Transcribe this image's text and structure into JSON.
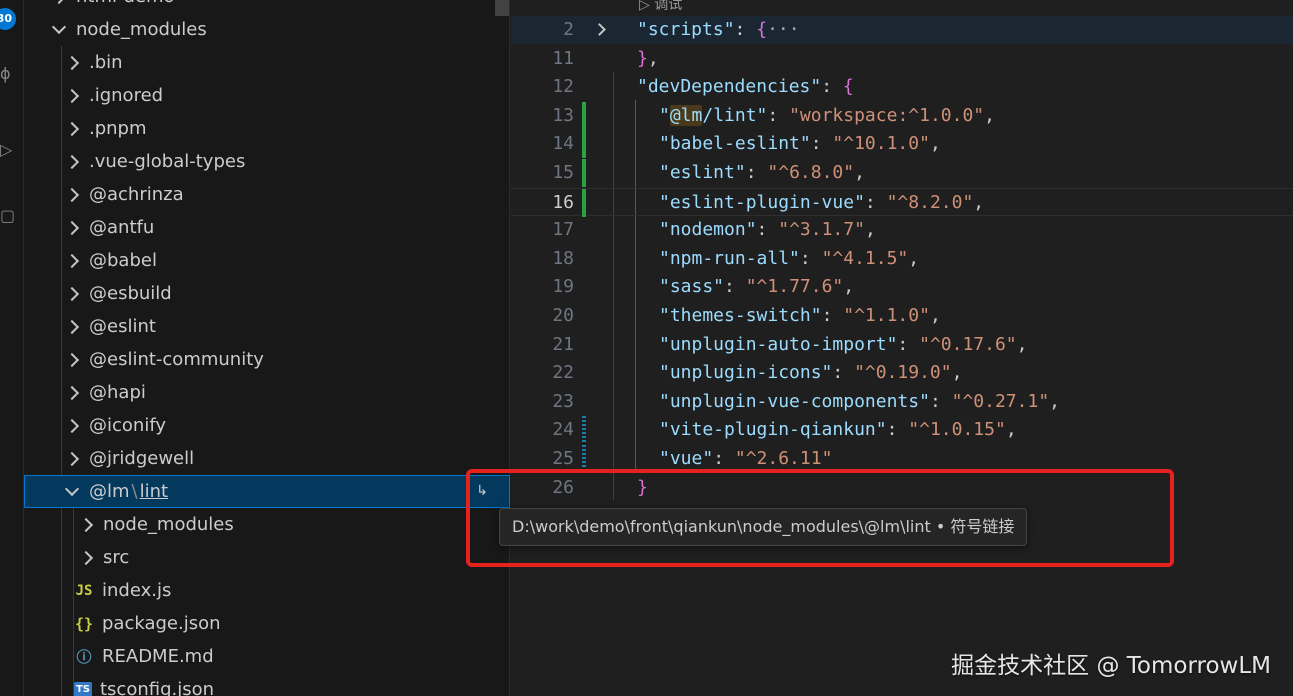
{
  "activity_bar": {
    "badge": "30",
    "icons": [
      "source-control-icon",
      "run-debug-icon",
      "extensions-icon"
    ]
  },
  "explorer": {
    "partial_top": "html-demo",
    "items": [
      {
        "label": "node_modules",
        "expanded": true,
        "depth": 0
      },
      {
        "label": ".bin",
        "expanded": false,
        "depth": 1
      },
      {
        "label": ".ignored",
        "expanded": false,
        "depth": 1
      },
      {
        "label": ".pnpm",
        "expanded": false,
        "depth": 1
      },
      {
        "label": ".vue-global-types",
        "expanded": false,
        "depth": 1
      },
      {
        "label": "@achrinza",
        "expanded": false,
        "depth": 1
      },
      {
        "label": "@antfu",
        "expanded": false,
        "depth": 1
      },
      {
        "label": "@babel",
        "expanded": false,
        "depth": 1
      },
      {
        "label": "@esbuild",
        "expanded": false,
        "depth": 1
      },
      {
        "label": "@eslint",
        "expanded": false,
        "depth": 1
      },
      {
        "label": "@eslint-community",
        "expanded": false,
        "depth": 1
      },
      {
        "label": "@hapi",
        "expanded": false,
        "depth": 1
      },
      {
        "label": "@iconify",
        "expanded": false,
        "depth": 1
      },
      {
        "label": "@jridgewell",
        "expanded": false,
        "depth": 1
      }
    ],
    "selected": {
      "scope": "@lm",
      "separator": "\\",
      "name": "lint"
    },
    "children": [
      {
        "label": "node_modules",
        "kind": "folder"
      },
      {
        "label": "src",
        "kind": "folder"
      },
      {
        "label": "index.js",
        "kind": "js",
        "icon_text": "JS"
      },
      {
        "label": "package.json",
        "kind": "json",
        "icon_text": "{}"
      },
      {
        "label": "README.md",
        "kind": "info",
        "icon_text": "ⓘ"
      },
      {
        "label": "tsconfig.json",
        "kind": "ts",
        "icon_text": "TS"
      }
    ],
    "symlink_glyph": "↳"
  },
  "editor": {
    "run_hint": "▷ 调试",
    "lines": [
      {
        "n": "2",
        "segs": [
          [
            "k",
            "\"scripts\""
          ],
          [
            "p",
            ": "
          ],
          [
            "b1",
            "{"
          ],
          [
            "e",
            "···"
          ]
        ],
        "fold": true,
        "sticky": true
      },
      {
        "n": "11",
        "segs": [
          [
            "b1",
            "}"
          ],
          [
            "p",
            ","
          ]
        ]
      },
      {
        "n": "12",
        "segs": [
          [
            "k",
            "\"devDependencies\""
          ],
          [
            "p",
            ": "
          ],
          [
            "b1",
            "{"
          ]
        ]
      },
      {
        "n": "13",
        "segs": [
          [
            "k",
            "\""
          ],
          [
            "khl",
            "@lm"
          ],
          [
            "k",
            "/lint\""
          ],
          [
            "p",
            ": "
          ],
          [
            "s",
            "\"workspace:^1.0.0\""
          ],
          [
            "p",
            ","
          ]
        ],
        "diff": "add",
        "indent": true
      },
      {
        "n": "14",
        "segs": [
          [
            "k",
            "\"babel-eslint\""
          ],
          [
            "p",
            ": "
          ],
          [
            "s",
            "\"^10.1.0\""
          ],
          [
            "p",
            ","
          ]
        ],
        "diff": "add",
        "indent": true
      },
      {
        "n": "15",
        "segs": [
          [
            "k",
            "\"eslint\""
          ],
          [
            "p",
            ": "
          ],
          [
            "s",
            "\"^6.8.0\""
          ],
          [
            "p",
            ","
          ]
        ],
        "diff": "add",
        "indent": true
      },
      {
        "n": "16",
        "segs": [
          [
            "k",
            "\"eslint-plugin-vue\""
          ],
          [
            "p",
            ": "
          ],
          [
            "s",
            "\"^8.2.0\""
          ],
          [
            "p",
            ","
          ]
        ],
        "diff": "add",
        "indent": true,
        "current": true
      },
      {
        "n": "17",
        "segs": [
          [
            "k",
            "\"nodemon\""
          ],
          [
            "p",
            ": "
          ],
          [
            "s",
            "\"^3.1.7\""
          ],
          [
            "p",
            ","
          ]
        ],
        "indent": true
      },
      {
        "n": "18",
        "segs": [
          [
            "k",
            "\"npm-run-all\""
          ],
          [
            "p",
            ": "
          ],
          [
            "s",
            "\"^4.1.5\""
          ],
          [
            "p",
            ","
          ]
        ],
        "indent": true
      },
      {
        "n": "19",
        "segs": [
          [
            "k",
            "\"sass\""
          ],
          [
            "p",
            ": "
          ],
          [
            "s",
            "\"^1.77.6\""
          ],
          [
            "p",
            ","
          ]
        ],
        "indent": true
      },
      {
        "n": "20",
        "segs": [
          [
            "k",
            "\"themes-switch\""
          ],
          [
            "p",
            ": "
          ],
          [
            "s",
            "\"^1.1.0\""
          ],
          [
            "p",
            ","
          ]
        ],
        "indent": true
      },
      {
        "n": "21",
        "segs": [
          [
            "k",
            "\"unplugin-auto-import\""
          ],
          [
            "p",
            ": "
          ],
          [
            "s",
            "\"^0.17.6\""
          ],
          [
            "p",
            ","
          ]
        ],
        "indent": true
      },
      {
        "n": "22",
        "segs": [
          [
            "k",
            "\"unplugin-icons\""
          ],
          [
            "p",
            ": "
          ],
          [
            "s",
            "\"^0.19.0\""
          ],
          [
            "p",
            ","
          ]
        ],
        "indent": true
      },
      {
        "n": "23",
        "segs": [
          [
            "k",
            "\"unplugin-vue-components\""
          ],
          [
            "p",
            ": "
          ],
          [
            "s",
            "\"^0.27.1\""
          ],
          [
            "p",
            ","
          ]
        ],
        "indent": true
      },
      {
        "n": "24",
        "segs": [
          [
            "k",
            "\"vite-plugin-qiankun\""
          ],
          [
            "p",
            ": "
          ],
          [
            "s",
            "\"^1.0.15\""
          ],
          [
            "p",
            ","
          ]
        ],
        "diff": "mod",
        "indent": true
      },
      {
        "n": "25",
        "segs": [
          [
            "k",
            "\"vue\""
          ],
          [
            "p",
            ": "
          ],
          [
            "s",
            "\"^2.6.11\""
          ]
        ],
        "diff": "mod",
        "indent": true
      },
      {
        "n": "26",
        "segs": [
          [
            "b1",
            "}"
          ]
        ]
      }
    ]
  },
  "tooltip": {
    "text": "D:\\work\\demo\\front\\qiankun\\node_modules\\@lm\\lint • 符号链接"
  },
  "watermark": "掘金技术社区 @ TomorrowLM",
  "colors": {
    "accent": "#0078d4",
    "annotation_red": "#e5221d",
    "diff_added": "#2ea043",
    "diff_modified": "#1b81a8"
  }
}
